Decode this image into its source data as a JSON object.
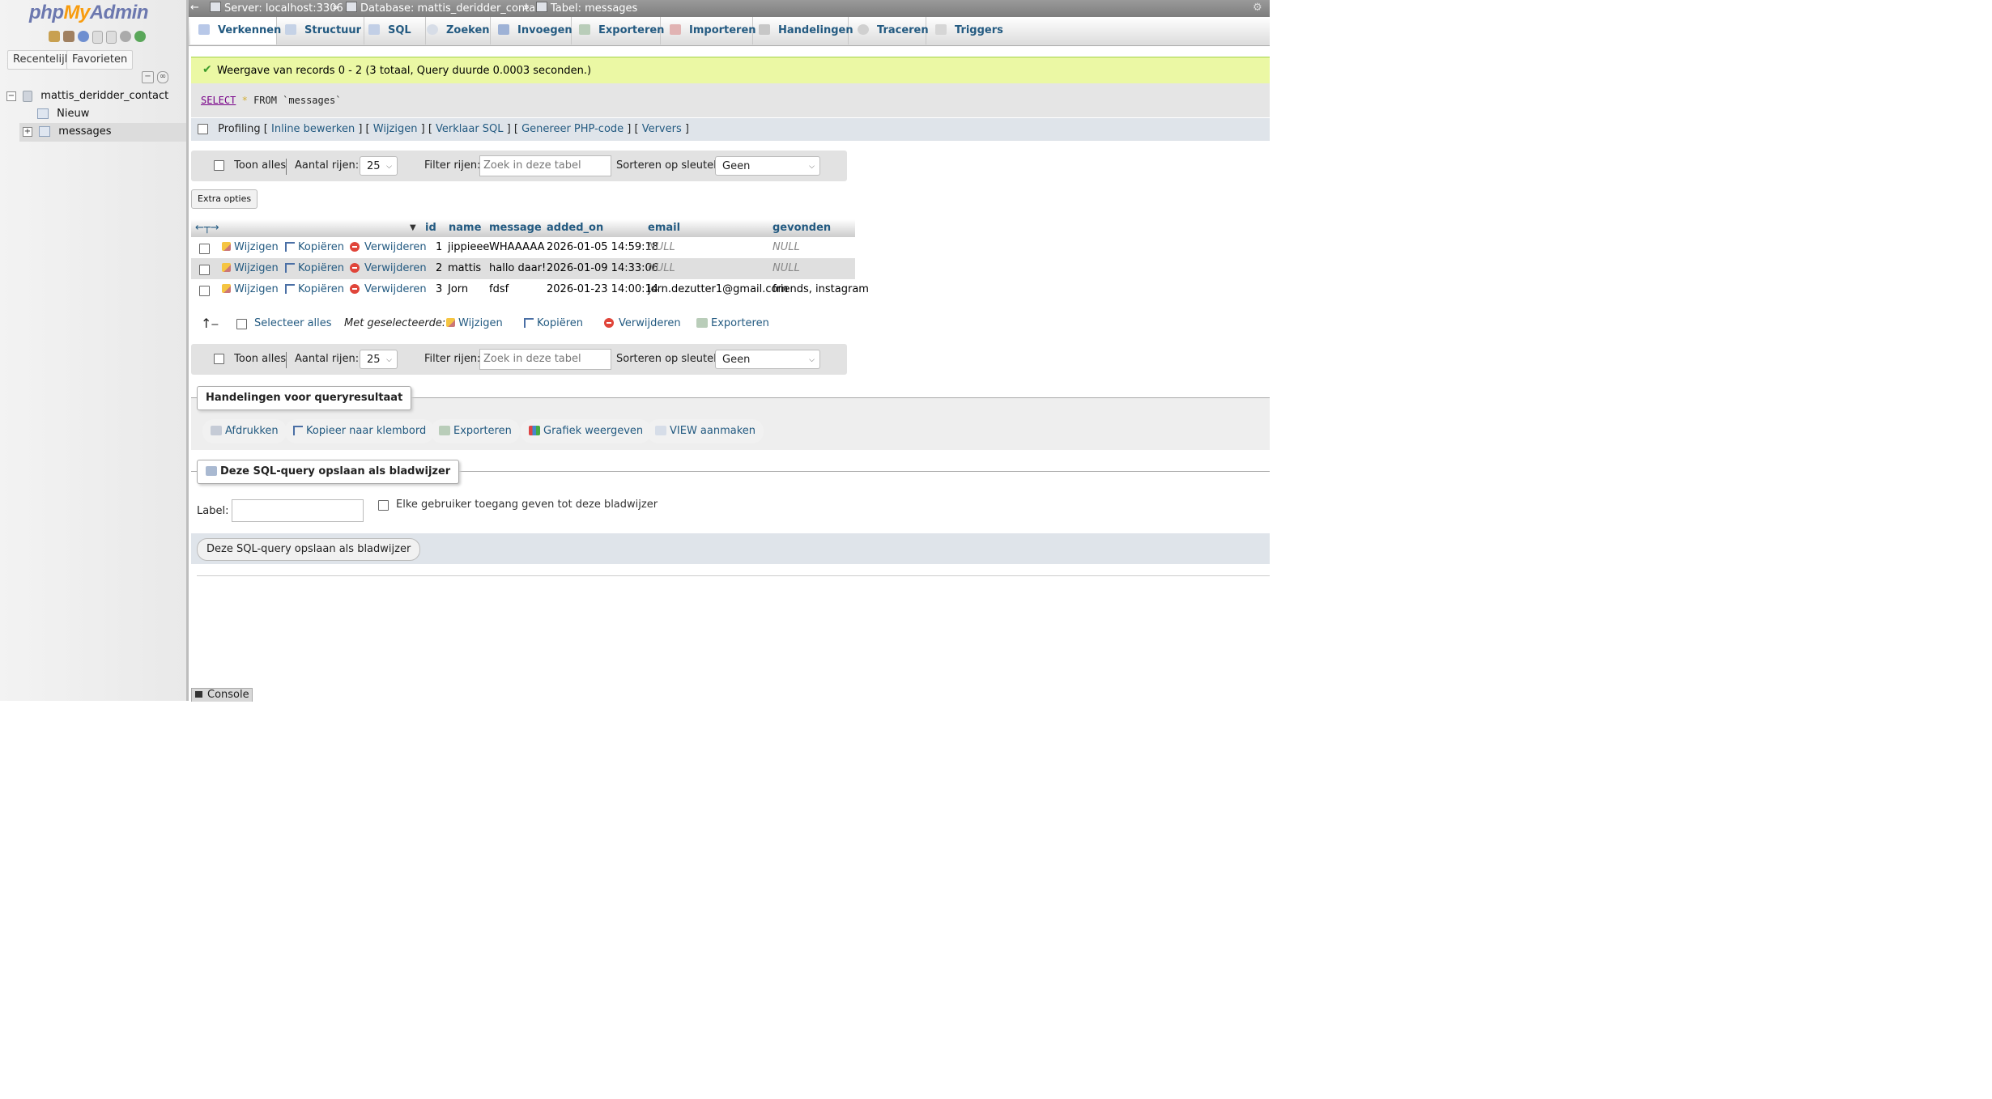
{
  "sidebar": {
    "logo": {
      "php": "php",
      "my": "My",
      "admin": "Admin"
    },
    "tabs": {
      "recent": "Recentelijk",
      "favorites": "Favorieten"
    },
    "tree": {
      "database": "mattis_deridder_contact",
      "new": "Nieuw",
      "table": "messages"
    }
  },
  "breadcrumb": {
    "server": "Server: localhost:3306",
    "database": "Database: mattis_deridder_contact",
    "table": "Tabel: messages",
    "sep": "»"
  },
  "tabs": [
    {
      "label": "Verkennen",
      "icon": "browse-icon",
      "color": "#6b8ec8"
    },
    {
      "label": "Structuur",
      "icon": "structure-icon",
      "color": "#7a9bd0"
    },
    {
      "label": "SQL",
      "icon": "sql-icon",
      "color": "#7090c8"
    },
    {
      "label": "Zoeken",
      "icon": "search-icon",
      "color": "#9aa9c0"
    },
    {
      "label": "Invoegen",
      "icon": "insert-icon",
      "color": "#5a77a8"
    },
    {
      "label": "Exporteren",
      "icon": "export-icon",
      "color": "#6e8f6e"
    },
    {
      "label": "Importeren",
      "icon": "import-icon",
      "color": "#b55a5a"
    },
    {
      "label": "Handelingen",
      "icon": "wrench-icon",
      "color": "#8a8a8a"
    },
    {
      "label": "Traceren",
      "icon": "eye-icon",
      "color": "#888"
    },
    {
      "label": "Triggers",
      "icon": "triggers-icon",
      "color": "#999"
    }
  ],
  "notice": "Weergave van records 0 - 2 (3 totaal, Query duurde 0.0003 seconden.)",
  "sql": {
    "select": "SELECT",
    "star": "*",
    "rest": "FROM `messages`"
  },
  "profiling": {
    "label": "Profiling",
    "links": [
      "Inline bewerken",
      "Wijzigen",
      "Verklaar SQL",
      "Genereer PHP-code",
      "Ververs"
    ]
  },
  "navform": {
    "show_all": "Toon alles",
    "rows_label": "Aantal rijen:",
    "rows_value": "25",
    "filter_label": "Filter rijen:",
    "filter_placeholder": "Zoek in deze tabel",
    "sort_label": "Sorteren op sleutel:",
    "sort_value": "Geen"
  },
  "extra_options": "Extra opties",
  "table": {
    "columns": [
      "id",
      "name",
      "message",
      "added_on",
      "email",
      "gevonden"
    ],
    "actions": {
      "edit": "Wijzigen",
      "copy": "Kopiëren",
      "delete": "Verwijderen"
    },
    "rows": [
      {
        "id": "1",
        "name": "jippieee",
        "message": "WHAAAAA",
        "added_on": "2026-01-05 14:59:18",
        "email": "NULL",
        "gevonden": "NULL"
      },
      {
        "id": "2",
        "name": "mattis",
        "message": "hallo daar!",
        "added_on": "2026-01-09 14:33:06",
        "email": "NULL",
        "gevonden": "NULL"
      },
      {
        "id": "3",
        "name": "Jorn",
        "message": "fdsf",
        "added_on": "2026-01-23 14:00:14",
        "email": "jorn.dezutter1@gmail.com",
        "gevonden": "friends, instagram"
      }
    ]
  },
  "bulk": {
    "select_all": "Selecteer alles",
    "with_selected": "Met geselecteerde:",
    "edit": "Wijzigen",
    "copy": "Kopiëren",
    "delete": "Verwijderen",
    "export": "Exporteren"
  },
  "query_ops": {
    "legend": "Handelingen voor queryresultaat",
    "print": "Afdrukken",
    "copy_clipboard": "Kopieer naar klembord",
    "export": "Exporteren",
    "chart": "Grafiek weergeven",
    "view": "VIEW aanmaken"
  },
  "bookmark": {
    "legend": "Deze SQL-query opslaan als bladwijzer",
    "label": "Label:",
    "label_value": "",
    "share": "Elke gebruiker toegang geven tot deze bladwijzer",
    "submit": "Deze SQL-query opslaan als bladwijzer"
  },
  "console": "Console"
}
